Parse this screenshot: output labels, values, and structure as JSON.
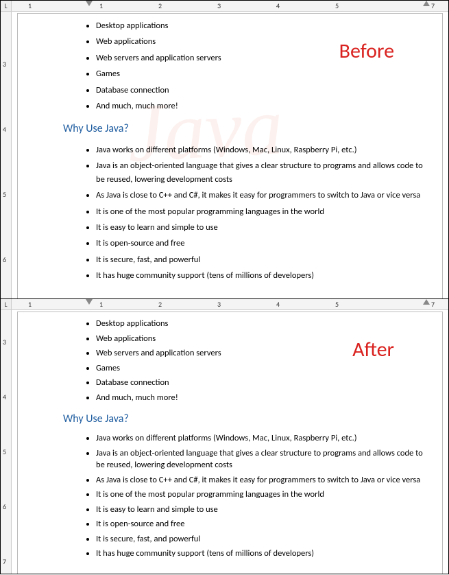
{
  "overlay": {
    "before": "Before",
    "after": "After"
  },
  "ruler_corner": "L",
  "h_ruler_numbers": [
    "1",
    "1",
    "2",
    "3",
    "4",
    "5",
    "7"
  ],
  "v_ruler_top_numbers": [
    "3",
    "4",
    "5",
    "6"
  ],
  "v_ruler_bottom_numbers": [
    "3",
    "4",
    "5",
    "6",
    "7"
  ],
  "watermark_text": "Java",
  "list1": {
    "items": [
      "Desktop applications",
      "Web applications",
      "Web servers and application servers",
      "Games",
      "Database connection",
      "And much, much more!"
    ]
  },
  "heading": "Why Use Java?",
  "list2": {
    "items": [
      "Java works on different platforms (Windows, Mac, Linux, Raspberry Pi, etc.)",
      "Java is an object-oriented language that gives a clear structure to programs and allows code to be reused, lowering development costs",
      "As Java is close to C++ and C#, it makes it easy for programmers to switch to Java or vice versa",
      "It is one of the most popular programming languages in the world",
      "It is easy to learn and simple to use",
      "It is open-source and free",
      "It is secure, fast, and powerful",
      "It has huge community support (tens of millions of developers)"
    ]
  }
}
